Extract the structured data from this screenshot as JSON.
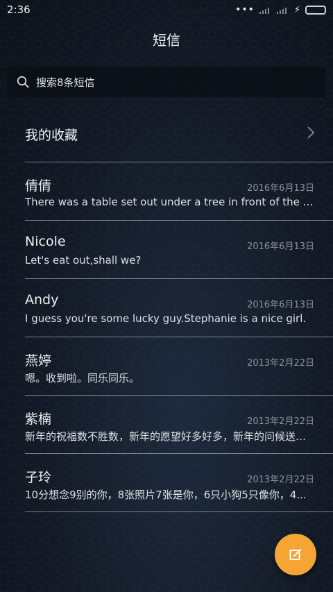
{
  "status_bar": {
    "time": "2:36",
    "dots": "•••",
    "bolt": "⚡"
  },
  "header": {
    "title": "短信"
  },
  "search": {
    "placeholder": "搜索8条短信"
  },
  "favorites": {
    "label": "我的收藏"
  },
  "messages": [
    {
      "name": "倩倩",
      "date": "2016年6月13日",
      "snippet": "There was a table set out under a tree in front of the house..."
    },
    {
      "name": "Nicole",
      "date": "2016年6月13日",
      "snippet": "Let's eat out,shall we?"
    },
    {
      "name": "Andy",
      "date": "2016年6月13日",
      "snippet": "I guess you're some lucky guy.Stephanie is a nice girl."
    },
    {
      "name": "燕婷",
      "date": "2013年2月22日",
      "snippet": "嗯。收到啦。同乐同乐。"
    },
    {
      "name": "紫楠",
      "date": "2013年2月22日",
      "snippet": "新年的祝福数不胜数，新年的愿望好多好多，新年的问候送给你..."
    },
    {
      "name": "子玲",
      "date": "2013年2月22日",
      "snippet": "10分想念9别的你，8张照片7张是你，6只小狗5只像你，4..."
    }
  ],
  "colors": {
    "fab": "#f5a533",
    "battery": "#56e23d"
  },
  "icons": [
    "search-icon",
    "chevron-right-icon",
    "compose-icon",
    "battery-icon",
    "signal-icon"
  ]
}
